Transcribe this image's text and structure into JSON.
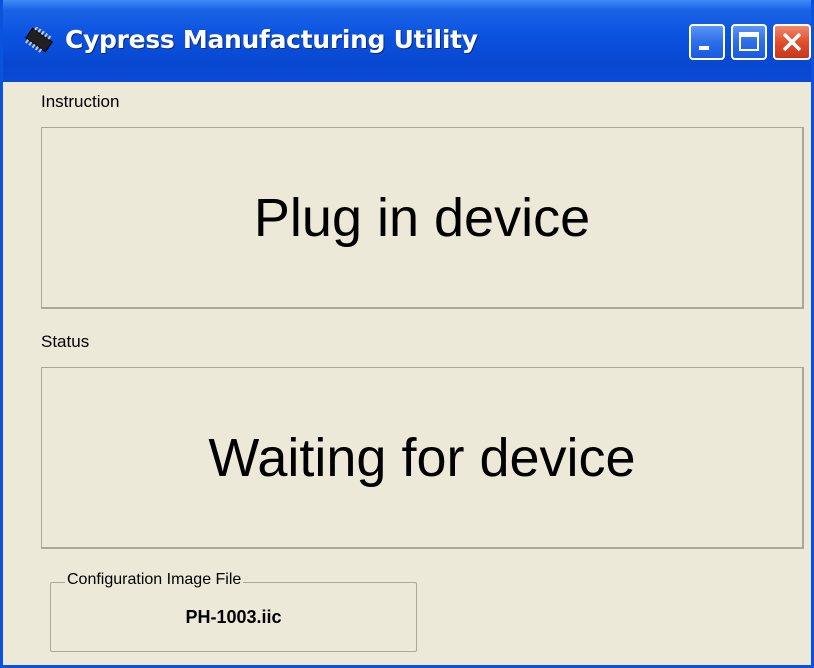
{
  "window": {
    "title": "Cypress Manufacturing Utility",
    "icon": "chip-icon",
    "controls": {
      "minimize": "minimize-icon",
      "maximize": "maximize-icon",
      "close": "close-icon"
    }
  },
  "instruction": {
    "label": "Instruction",
    "text": "Plug in device"
  },
  "status": {
    "label": "Status",
    "text": "Waiting for device"
  },
  "config": {
    "label": "Configuration Image File",
    "value": "PH-1003.iic"
  },
  "colors": {
    "titlebar": "#0a52df",
    "client_bg": "#ece9d8",
    "close_button": "#e2532f"
  }
}
